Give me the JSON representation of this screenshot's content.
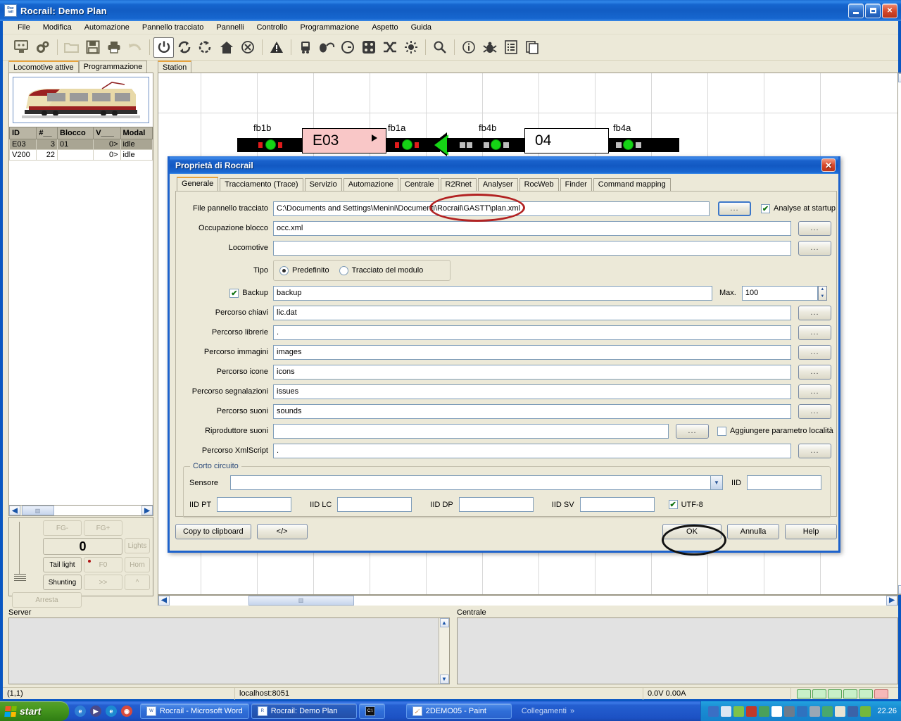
{
  "window": {
    "title": "Rocrail: Demo Plan",
    "icon": "rocrail-icon",
    "minimize_label": "Minimize",
    "maximize_label": "Maximize",
    "close_label": "Close"
  },
  "menubar": {
    "items": [
      "File",
      "Modifica",
      "Automazione",
      "Pannello tracciato",
      "Pannelli",
      "Controllo",
      "Programmazione",
      "Aspetto",
      "Guida"
    ]
  },
  "toolbar": {
    "icons": [
      "monitor-icon",
      "gears-icon",
      "open-folder-icon",
      "save-icon",
      "print-icon",
      "undo-arrow-icon",
      "power-icon",
      "sync-icon",
      "reset-icon",
      "home-icon",
      "stop-circle-icon",
      "warning-icon",
      "locomotive-icon",
      "mouse-icon",
      "clock-icon",
      "blocks-icon",
      "shuffle-icon",
      "light-icon",
      "magnifier-icon",
      "info-icon",
      "bug-icon",
      "list-icon",
      "copy-icon"
    ]
  },
  "left_panel": {
    "tabs": [
      {
        "label": "Locomotive attive",
        "active": true
      },
      {
        "label": "Programmazione",
        "active": false
      }
    ],
    "loco_image_alt": "electric-locomotive-photo",
    "table": {
      "columns": [
        "ID",
        "#__",
        "Blocco",
        "V___",
        "Modal"
      ],
      "rows": [
        {
          "id": "E03",
          "num": "3",
          "blocco": "01",
          "v": "0>",
          "modal": "idle",
          "selected": true
        },
        {
          "id": "V200",
          "num": "22",
          "blocco": "",
          "v": "0>",
          "modal": "idle",
          "selected": false
        }
      ]
    },
    "control_panel": {
      "fg_minus": "FG-",
      "fg_plus": "FG+",
      "speed": "0",
      "lights": "Lights",
      "tail_light": "Tail light",
      "f0": "F0",
      "horn": "Horn",
      "shunting": "Shunting",
      "forward": ">>",
      "up": "^",
      "stop": "Arresta"
    }
  },
  "plan": {
    "tabs": [
      {
        "label": "Station",
        "active": true
      }
    ],
    "elements": [
      {
        "type": "sensor-label",
        "text": "fb1b"
      },
      {
        "type": "block",
        "text": "E03",
        "color": "#f9c7c7"
      },
      {
        "type": "sensor-label",
        "text": "fb1a"
      },
      {
        "type": "sensor-label",
        "text": "fb4b"
      },
      {
        "type": "block",
        "text": "04",
        "color": "#ffffff"
      },
      {
        "type": "sensor-label",
        "text": "fb4a"
      }
    ],
    "labels": {
      "fb1b": "fb1b",
      "fb1a": "fb1a",
      "fb4b": "fb4b",
      "fb4a": "fb4a",
      "block_e03": "E03",
      "block_04": "04"
    }
  },
  "logs": {
    "server_label": "Server",
    "centrale_label": "Centrale"
  },
  "statusbar": {
    "coords": "(1,1)",
    "host": "localhost:8051",
    "power": "0.0V 0.00A"
  },
  "taskbar": {
    "start_label": "start",
    "buttons": [
      {
        "label": "Rocrail - Microsoft Word",
        "icon": "word-icon",
        "active": false
      },
      {
        "label": "Rocrail: Demo Plan",
        "icon": "rocrail-icon",
        "active": true
      },
      {
        "label": "",
        "icon": "console-icon",
        "active": false
      },
      {
        "label": "2DEMO05 - Paint",
        "icon": "paint-icon",
        "active": false
      }
    ],
    "links_label": "Collegamenti",
    "links_chevron": "»",
    "clock": "22.26"
  },
  "dialog": {
    "title": "Proprietà di Rocrail",
    "close_label": "✕",
    "tabs": [
      {
        "label": "Generale",
        "active": true
      },
      {
        "label": "Tracciamento (Trace)",
        "active": false
      },
      {
        "label": "Servizio",
        "active": false
      },
      {
        "label": "Automazione",
        "active": false
      },
      {
        "label": "Centrale",
        "active": false
      },
      {
        "label": "R2Rnet",
        "active": false
      },
      {
        "label": "Analyser",
        "active": false
      },
      {
        "label": "RocWeb",
        "active": false
      },
      {
        "label": "Finder",
        "active": false
      },
      {
        "label": "Command mapping",
        "active": false
      }
    ],
    "fields": {
      "plan_file": {
        "label": "File pannello tracciato",
        "value": "C:\\Documents and Settings\\Menini\\Documenti\\Rocrail\\GASTT\\plan.xml",
        "button": "...",
        "checkbox_label": "Analyse at startup",
        "checkbox_checked": true
      },
      "block_occupancy": {
        "label": "Occupazione blocco",
        "value": "occ.xml",
        "button": "..."
      },
      "locomotive": {
        "label": "Locomotive",
        "value": "",
        "button": "..."
      },
      "type": {
        "label": "Tipo",
        "options": [
          {
            "label": "Predefinito",
            "selected": true
          },
          {
            "label": "Tracciato del modulo",
            "selected": false
          }
        ]
      },
      "backup": {
        "label": "Backup",
        "checked": true,
        "value": "backup",
        "max_label": "Max.",
        "max_value": "100"
      },
      "keys_path": {
        "label": "Percorso chiavi",
        "value": "lic.dat",
        "button": "..."
      },
      "library_path": {
        "label": "Percorso librerie",
        "value": ".",
        "button": "..."
      },
      "images_path": {
        "label": "Percorso immagini",
        "value": "images",
        "button": "..."
      },
      "icons_path": {
        "label": "Percorso icone",
        "value": "icons",
        "button": "..."
      },
      "issues_path": {
        "label": "Percorso segnalazioni",
        "value": "issues",
        "button": "..."
      },
      "sounds_path": {
        "label": "Percorso suoni",
        "value": "sounds",
        "button": "..."
      },
      "sound_player": {
        "label": "Riproduttore suoni",
        "value": "",
        "button": "...",
        "checkbox_label": "Aggiungere parametro località",
        "checkbox_checked": false
      },
      "xmlscript_path": {
        "label": "Percorso XmlScript",
        "value": ".",
        "button": "..."
      }
    },
    "short_circuit": {
      "title": "Corto circuito",
      "sensor_label": "Sensore",
      "sensor_value": "",
      "iid_label": "IID",
      "iid_value": "",
      "iid_pt_label": "IID PT",
      "iid_pt_value": "",
      "iid_lc_label": "IID LC",
      "iid_lc_value": "",
      "iid_dp_label": "IID DP",
      "iid_dp_value": "",
      "iid_sv_label": "IID SV",
      "iid_sv_value": "",
      "utf8_label": "UTF-8",
      "utf8_checked": true
    },
    "buttons": {
      "copy": "Copy to clipboard",
      "xml": "</>",
      "ok": "OK",
      "cancel": "Annulla",
      "help": "Help"
    }
  },
  "annotations": {
    "red_ellipse_target": "plan-file-path-highlight",
    "black_ellipse_target": "ok-button-highlight"
  },
  "colors": {
    "titlebar_blue": "#1258c2",
    "desktop_chrome": "#ece9d8",
    "block_occupied": "#f9c7c7",
    "sensor_green": "#15d415",
    "annotation_red": "#b22222",
    "tab_accent": "#e8a33d"
  }
}
